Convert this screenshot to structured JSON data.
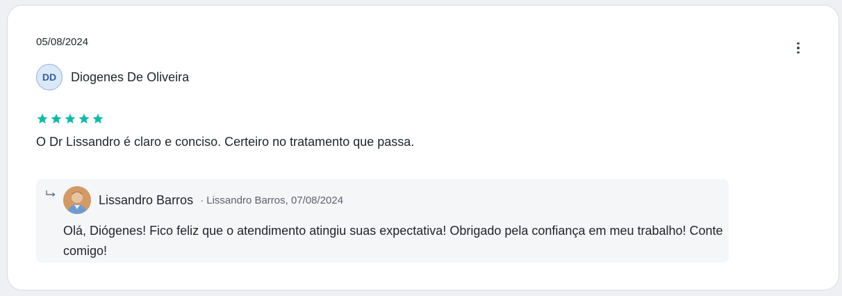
{
  "review": {
    "date": "05/08/2024",
    "author": {
      "initials": "DD",
      "name": "Diogenes De Oliveira"
    },
    "rating": 5,
    "rating_max": 5,
    "text": "O Dr Lissandro é claro e conciso. Certeiro no tratamento que passa.",
    "star_color": "#14b8a6",
    "menu_icon": "more-vertical-icon"
  },
  "reply": {
    "icon": "reply-arrow-icon",
    "name": "Lissandro Barros",
    "meta": "· Lissandro Barros, 07/08/2024",
    "text": "Olá, Diógenes! Fico feliz que o atendimento atingiu suas expectativa! Obrigado pela confiança em meu trabalho! Conte comigo!"
  }
}
